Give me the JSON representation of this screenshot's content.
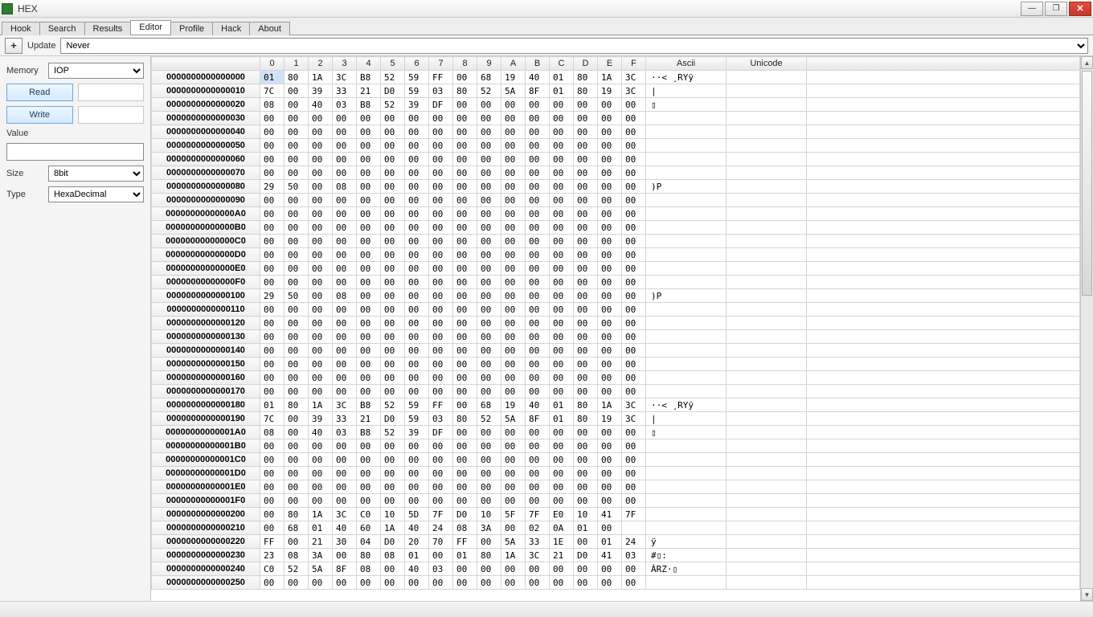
{
  "window": {
    "title": "HEX"
  },
  "tabs": [
    "Hook",
    "Search",
    "Results",
    "Editor",
    "Profile",
    "Hack",
    "About"
  ],
  "active_tab": "Editor",
  "toolbar": {
    "add": "+",
    "update_label": "Update",
    "update_value": "Never"
  },
  "sidebar": {
    "memory_label": "Memory",
    "memory_value": "IOP",
    "read": "Read",
    "write": "Write",
    "value_label": "Value",
    "value": "",
    "size_label": "Size",
    "size_value": "8bit",
    "type_label": "Type",
    "type_value": "HexaDecimal"
  },
  "columns": [
    "",
    "0",
    "1",
    "2",
    "3",
    "4",
    "5",
    "6",
    "7",
    "8",
    "9",
    "A",
    "B",
    "C",
    "D",
    "E",
    "F",
    "Ascii",
    "Unicode"
  ],
  "rows": [
    {
      "addr": "0000000000000000",
      "b": [
        "01",
        "80",
        "1A",
        "3C",
        "B8",
        "52",
        "59",
        "FF",
        "00",
        "68",
        "19",
        "40",
        "01",
        "80",
        "1A",
        "3C"
      ],
      "ascii": "··< ¸RYÿ"
    },
    {
      "addr": "0000000000000010",
      "b": [
        "7C",
        "00",
        "39",
        "33",
        "21",
        "D0",
        "59",
        "03",
        "80",
        "52",
        "5A",
        "8F",
        "01",
        "80",
        "19",
        "3C"
      ],
      "ascii": "|"
    },
    {
      "addr": "0000000000000020",
      "b": [
        "08",
        "00",
        "40",
        "03",
        "B8",
        "52",
        "39",
        "DF",
        "00",
        "00",
        "00",
        "00",
        "00",
        "00",
        "00",
        "00"
      ],
      "ascii": "▯"
    },
    {
      "addr": "0000000000000030",
      "b": [
        "00",
        "00",
        "00",
        "00",
        "00",
        "00",
        "00",
        "00",
        "00",
        "00",
        "00",
        "00",
        "00",
        "00",
        "00",
        "00"
      ],
      "ascii": ""
    },
    {
      "addr": "0000000000000040",
      "b": [
        "00",
        "00",
        "00",
        "00",
        "00",
        "00",
        "00",
        "00",
        "00",
        "00",
        "00",
        "00",
        "00",
        "00",
        "00",
        "00"
      ],
      "ascii": ""
    },
    {
      "addr": "0000000000000050",
      "b": [
        "00",
        "00",
        "00",
        "00",
        "00",
        "00",
        "00",
        "00",
        "00",
        "00",
        "00",
        "00",
        "00",
        "00",
        "00",
        "00"
      ],
      "ascii": ""
    },
    {
      "addr": "0000000000000060",
      "b": [
        "00",
        "00",
        "00",
        "00",
        "00",
        "00",
        "00",
        "00",
        "00",
        "00",
        "00",
        "00",
        "00",
        "00",
        "00",
        "00"
      ],
      "ascii": ""
    },
    {
      "addr": "0000000000000070",
      "b": [
        "00",
        "00",
        "00",
        "00",
        "00",
        "00",
        "00",
        "00",
        "00",
        "00",
        "00",
        "00",
        "00",
        "00",
        "00",
        "00"
      ],
      "ascii": ""
    },
    {
      "addr": "0000000000000080",
      "b": [
        "29",
        "50",
        "00",
        "08",
        "00",
        "00",
        "00",
        "00",
        "00",
        "00",
        "00",
        "00",
        "00",
        "00",
        "00",
        "00"
      ],
      "ascii": ")P"
    },
    {
      "addr": "0000000000000090",
      "b": [
        "00",
        "00",
        "00",
        "00",
        "00",
        "00",
        "00",
        "00",
        "00",
        "00",
        "00",
        "00",
        "00",
        "00",
        "00",
        "00"
      ],
      "ascii": ""
    },
    {
      "addr": "00000000000000A0",
      "b": [
        "00",
        "00",
        "00",
        "00",
        "00",
        "00",
        "00",
        "00",
        "00",
        "00",
        "00",
        "00",
        "00",
        "00",
        "00",
        "00"
      ],
      "ascii": ""
    },
    {
      "addr": "00000000000000B0",
      "b": [
        "00",
        "00",
        "00",
        "00",
        "00",
        "00",
        "00",
        "00",
        "00",
        "00",
        "00",
        "00",
        "00",
        "00",
        "00",
        "00"
      ],
      "ascii": ""
    },
    {
      "addr": "00000000000000C0",
      "b": [
        "00",
        "00",
        "00",
        "00",
        "00",
        "00",
        "00",
        "00",
        "00",
        "00",
        "00",
        "00",
        "00",
        "00",
        "00",
        "00"
      ],
      "ascii": ""
    },
    {
      "addr": "00000000000000D0",
      "b": [
        "00",
        "00",
        "00",
        "00",
        "00",
        "00",
        "00",
        "00",
        "00",
        "00",
        "00",
        "00",
        "00",
        "00",
        "00",
        "00"
      ],
      "ascii": ""
    },
    {
      "addr": "00000000000000E0",
      "b": [
        "00",
        "00",
        "00",
        "00",
        "00",
        "00",
        "00",
        "00",
        "00",
        "00",
        "00",
        "00",
        "00",
        "00",
        "00",
        "00"
      ],
      "ascii": ""
    },
    {
      "addr": "00000000000000F0",
      "b": [
        "00",
        "00",
        "00",
        "00",
        "00",
        "00",
        "00",
        "00",
        "00",
        "00",
        "00",
        "00",
        "00",
        "00",
        "00",
        "00"
      ],
      "ascii": ""
    },
    {
      "addr": "0000000000000100",
      "b": [
        "29",
        "50",
        "00",
        "08",
        "00",
        "00",
        "00",
        "00",
        "00",
        "00",
        "00",
        "00",
        "00",
        "00",
        "00",
        "00"
      ],
      "ascii": ")P"
    },
    {
      "addr": "0000000000000110",
      "b": [
        "00",
        "00",
        "00",
        "00",
        "00",
        "00",
        "00",
        "00",
        "00",
        "00",
        "00",
        "00",
        "00",
        "00",
        "00",
        "00"
      ],
      "ascii": ""
    },
    {
      "addr": "0000000000000120",
      "b": [
        "00",
        "00",
        "00",
        "00",
        "00",
        "00",
        "00",
        "00",
        "00",
        "00",
        "00",
        "00",
        "00",
        "00",
        "00",
        "00"
      ],
      "ascii": ""
    },
    {
      "addr": "0000000000000130",
      "b": [
        "00",
        "00",
        "00",
        "00",
        "00",
        "00",
        "00",
        "00",
        "00",
        "00",
        "00",
        "00",
        "00",
        "00",
        "00",
        "00"
      ],
      "ascii": ""
    },
    {
      "addr": "0000000000000140",
      "b": [
        "00",
        "00",
        "00",
        "00",
        "00",
        "00",
        "00",
        "00",
        "00",
        "00",
        "00",
        "00",
        "00",
        "00",
        "00",
        "00"
      ],
      "ascii": ""
    },
    {
      "addr": "0000000000000150",
      "b": [
        "00",
        "00",
        "00",
        "00",
        "00",
        "00",
        "00",
        "00",
        "00",
        "00",
        "00",
        "00",
        "00",
        "00",
        "00",
        "00"
      ],
      "ascii": ""
    },
    {
      "addr": "0000000000000160",
      "b": [
        "00",
        "00",
        "00",
        "00",
        "00",
        "00",
        "00",
        "00",
        "00",
        "00",
        "00",
        "00",
        "00",
        "00",
        "00",
        "00"
      ],
      "ascii": ""
    },
    {
      "addr": "0000000000000170",
      "b": [
        "00",
        "00",
        "00",
        "00",
        "00",
        "00",
        "00",
        "00",
        "00",
        "00",
        "00",
        "00",
        "00",
        "00",
        "00",
        "00"
      ],
      "ascii": ""
    },
    {
      "addr": "0000000000000180",
      "b": [
        "01",
        "80",
        "1A",
        "3C",
        "B8",
        "52",
        "59",
        "FF",
        "00",
        "68",
        "19",
        "40",
        "01",
        "80",
        "1A",
        "3C"
      ],
      "ascii": "··< ¸RYÿ"
    },
    {
      "addr": "0000000000000190",
      "b": [
        "7C",
        "00",
        "39",
        "33",
        "21",
        "D0",
        "59",
        "03",
        "80",
        "52",
        "5A",
        "8F",
        "01",
        "80",
        "19",
        "3C"
      ],
      "ascii": "|"
    },
    {
      "addr": "00000000000001A0",
      "b": [
        "08",
        "00",
        "40",
        "03",
        "B8",
        "52",
        "39",
        "DF",
        "00",
        "00",
        "00",
        "00",
        "00",
        "00",
        "00",
        "00"
      ],
      "ascii": "▯"
    },
    {
      "addr": "00000000000001B0",
      "b": [
        "00",
        "00",
        "00",
        "00",
        "00",
        "00",
        "00",
        "00",
        "00",
        "00",
        "00",
        "00",
        "00",
        "00",
        "00",
        "00"
      ],
      "ascii": ""
    },
    {
      "addr": "00000000000001C0",
      "b": [
        "00",
        "00",
        "00",
        "00",
        "00",
        "00",
        "00",
        "00",
        "00",
        "00",
        "00",
        "00",
        "00",
        "00",
        "00",
        "00"
      ],
      "ascii": ""
    },
    {
      "addr": "00000000000001D0",
      "b": [
        "00",
        "00",
        "00",
        "00",
        "00",
        "00",
        "00",
        "00",
        "00",
        "00",
        "00",
        "00",
        "00",
        "00",
        "00",
        "00"
      ],
      "ascii": ""
    },
    {
      "addr": "00000000000001E0",
      "b": [
        "00",
        "00",
        "00",
        "00",
        "00",
        "00",
        "00",
        "00",
        "00",
        "00",
        "00",
        "00",
        "00",
        "00",
        "00",
        "00"
      ],
      "ascii": ""
    },
    {
      "addr": "00000000000001F0",
      "b": [
        "00",
        "00",
        "00",
        "00",
        "00",
        "00",
        "00",
        "00",
        "00",
        "00",
        "00",
        "00",
        "00",
        "00",
        "00",
        "00"
      ],
      "ascii": ""
    },
    {
      "addr": "0000000000000200",
      "b": [
        "00",
        "80",
        "1A",
        "3C",
        "C0",
        "10",
        "5D",
        "7F",
        "D0",
        "10",
        "5F",
        "7F",
        "E0",
        "10",
        "41",
        "7F"
      ],
      "ascii": ""
    },
    {
      "addr": "0000000000000210",
      "b": [
        "00",
        "68",
        "01",
        "40",
        "60",
        "1A",
        "40",
        "24",
        "08",
        "3A",
        "00",
        "02",
        "0A",
        "01",
        "00",
        "  "
      ],
      "ascii": ""
    },
    {
      "addr": "0000000000000220",
      "b": [
        "FF",
        "00",
        "21",
        "30",
        "04",
        "D0",
        "20",
        "70",
        "FF",
        "00",
        "5A",
        "33",
        "1E",
        "00",
        "01",
        "24"
      ],
      "ascii": "ÿ"
    },
    {
      "addr": "0000000000000230",
      "b": [
        "23",
        "08",
        "3A",
        "00",
        "80",
        "08",
        "01",
        "00",
        "01",
        "80",
        "1A",
        "3C",
        "21",
        "D0",
        "41",
        "03"
      ],
      "ascii": "#▯:"
    },
    {
      "addr": "0000000000000240",
      "b": [
        "C0",
        "52",
        "5A",
        "8F",
        "08",
        "00",
        "40",
        "03",
        "00",
        "00",
        "00",
        "00",
        "00",
        "00",
        "00",
        "00"
      ],
      "ascii": "ÀRZ·▯"
    },
    {
      "addr": "0000000000000250",
      "b": [
        "00",
        "00",
        "00",
        "00",
        "00",
        "00",
        "00",
        "00",
        "00",
        "00",
        "00",
        "00",
        "00",
        "00",
        "00",
        "00"
      ],
      "ascii": ""
    }
  ]
}
